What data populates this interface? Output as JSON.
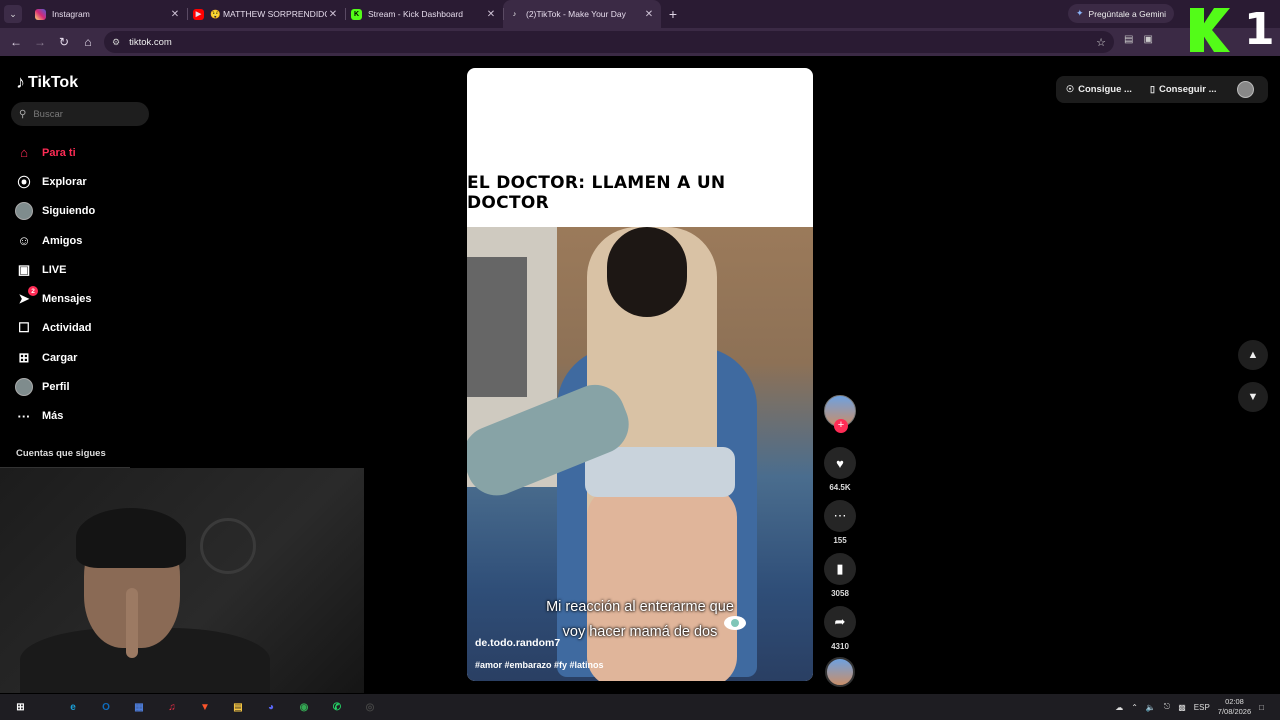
{
  "browser": {
    "tabs": [
      {
        "title": "Instagram",
        "favicon_color": "#d62976",
        "active": false
      },
      {
        "title": "😲 MATTHEW SORPRENDIDO",
        "favicon_color": "#ff0000",
        "active": false
      },
      {
        "title": "Stream - Kick Dashboard",
        "favicon_color": "#53fc18",
        "active": false
      },
      {
        "title": "(2)TikTok - Make Your Day",
        "favicon_color": "#000000",
        "active": true
      }
    ],
    "gemini_label": "Pregúntale a Gemini",
    "url": "tiktok.com",
    "overlay_number": "1"
  },
  "tiktok": {
    "logo": "TikTok",
    "search_placeholder": "Buscar",
    "nav": [
      {
        "label": "Para ti",
        "icon": "home-icon",
        "glyph": "⌂",
        "active": true
      },
      {
        "label": "Explorar",
        "icon": "compass-icon",
        "glyph": "⦿",
        "active": false
      },
      {
        "label": "Siguiendo",
        "icon": "following-avatar-icon",
        "glyph": "",
        "active": false
      },
      {
        "label": "Amigos",
        "icon": "friends-icon",
        "glyph": "☺",
        "active": false
      },
      {
        "label": "LIVE",
        "icon": "live-icon",
        "glyph": "▣",
        "active": false
      },
      {
        "label": "Mensajes",
        "icon": "messages-icon",
        "glyph": "➤",
        "badge": "2",
        "active": false
      },
      {
        "label": "Actividad",
        "icon": "activity-icon",
        "glyph": "☐",
        "active": false
      },
      {
        "label": "Cargar",
        "icon": "upload-icon",
        "glyph": "⊞",
        "active": false
      },
      {
        "label": "Perfil",
        "icon": "profile-avatar-icon",
        "glyph": "",
        "active": false
      },
      {
        "label": "Más",
        "icon": "more-icon",
        "glyph": "···",
        "active": false
      }
    ],
    "following_title": "Cuentas que sigues",
    "video": {
      "top_caption": "EL DOCTOR: LLAMEN A UN DOCTOR",
      "subtitle_line1": "Mi reacción al enterarme que",
      "subtitle_line2": "voy hacer mamá de dos",
      "author": "de.todo.random7",
      "hashtags": "#amor #embarazo #fy #latinos"
    },
    "actions": {
      "likes": "64.5K",
      "comments": "155",
      "saves": "3058",
      "shares": "4310"
    },
    "top_right": {
      "coins_label": "Consigue ...",
      "app_label": "Conseguir ..."
    }
  },
  "taskbar": {
    "apps": [
      {
        "name": "windows-start",
        "color": "#ffffff",
        "glyph": "⊞"
      },
      {
        "name": "edge",
        "color": "#1aa0d8",
        "glyph": "e"
      },
      {
        "name": "outlook",
        "color": "#0f6cbd",
        "glyph": "O"
      },
      {
        "name": "calculator",
        "color": "#4d7cd8",
        "glyph": "▦"
      },
      {
        "name": "music",
        "color": "#fa2d48",
        "glyph": "♫"
      },
      {
        "name": "brave",
        "color": "#fb542b",
        "glyph": "▼"
      },
      {
        "name": "file-explorer",
        "color": "#f4c542",
        "glyph": "▤"
      },
      {
        "name": "discord",
        "color": "#5865f2",
        "glyph": "◕"
      },
      {
        "name": "chrome",
        "color": "#34a853",
        "glyph": "◉"
      },
      {
        "name": "whatsapp",
        "color": "#25d366",
        "glyph": "✆"
      },
      {
        "name": "obs",
        "color": "#444444",
        "glyph": "◎"
      }
    ],
    "language": "ESP",
    "time": "02:08",
    "date": "7/08/2026"
  }
}
